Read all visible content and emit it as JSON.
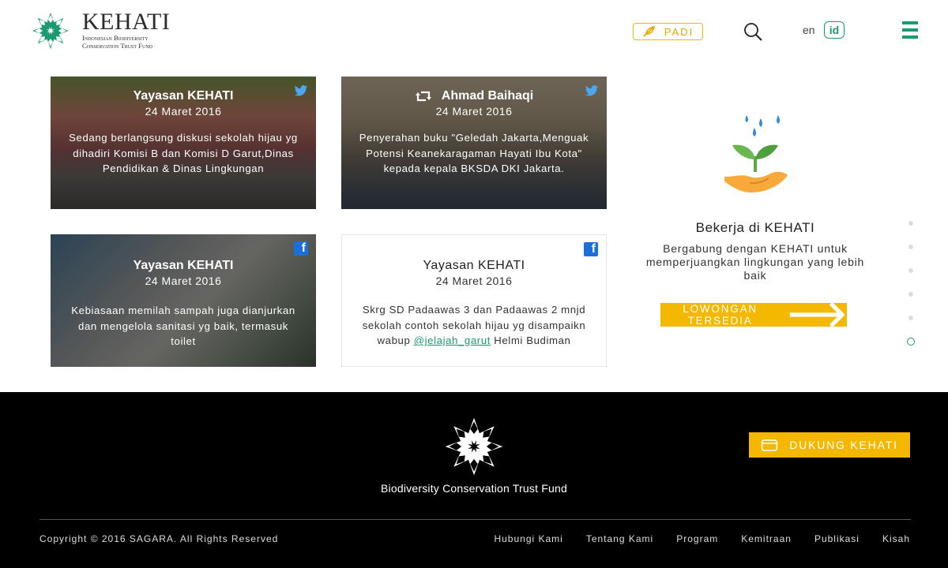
{
  "header": {
    "logo": {
      "word": "KEHATI",
      "sub_line1": "Indonesian Biodiversity",
      "sub_line2": "Conservation Trust Fund"
    },
    "padi_label": "PADI",
    "search_icon": "search-icon",
    "lang_en": "en",
    "lang_id": "id",
    "menu_icon": "hamburger-menu-icon",
    "accent_color": "#1a9a72",
    "yellow_color": "#f5b800"
  },
  "feed": [
    {
      "network": "twitter",
      "retweet": false,
      "author": "Yayasan KEHATI",
      "date": "24 Maret 2016",
      "text": "Sedang berlangsung diskusi sekolah hijau yg dihadiri Komisi B dan Komisi D Garut,Dinas Pendidikan & Dinas Lingkungan"
    },
    {
      "network": "twitter",
      "retweet": true,
      "author": "Ahmad Baihaqi",
      "date": "24 Maret 2016",
      "text": "Penyerahan buku \"Geledah Jakarta,Menguak Potensi Keanekaragaman Hayati Ibu Kota\" kepada kepala BKSDA DKI Jakarta."
    },
    {
      "network": "facebook",
      "retweet": false,
      "author": "Yayasan KEHATI",
      "date": "24 Maret 2016",
      "text": "Kebiasaan memilah sampah juga dianjurkan dan mengelola sanitasi yg baik, termasuk toilet"
    },
    {
      "network": "facebook",
      "retweet": false,
      "author": "Yayasan KEHATI",
      "date": "24 Maret 2016",
      "text_before": "Skrg SD Padaawas 3 dan Padaawas 2 mnjd sekolah contoh sekolah hijau yg disampaikn wabup ",
      "mention": "@jelajah_garut",
      "text_after": " Helmi Budiman"
    }
  ],
  "career": {
    "icon": "plant-in-hand-icon",
    "title": "Bekerja di KEHATI",
    "description": "Bergabung dengan KEHATI untuk memperjuangkan lingkungan yang lebih baik",
    "button_label": "LOWONGAN TERSEDIA"
  },
  "pager": {
    "count": 6,
    "active_index": 5
  },
  "footer": {
    "tagline": "Biodiversity Conservation Trust Fund",
    "support_label": "DUKUNG KEHATI",
    "copyright": "Copyright © 2016 SAGARA. All Rights Reserved",
    "links": [
      "Hubungi Kami",
      "Tentang Kami",
      "Program",
      "Kemitraan",
      "Publikasi",
      "Kisah"
    ]
  }
}
